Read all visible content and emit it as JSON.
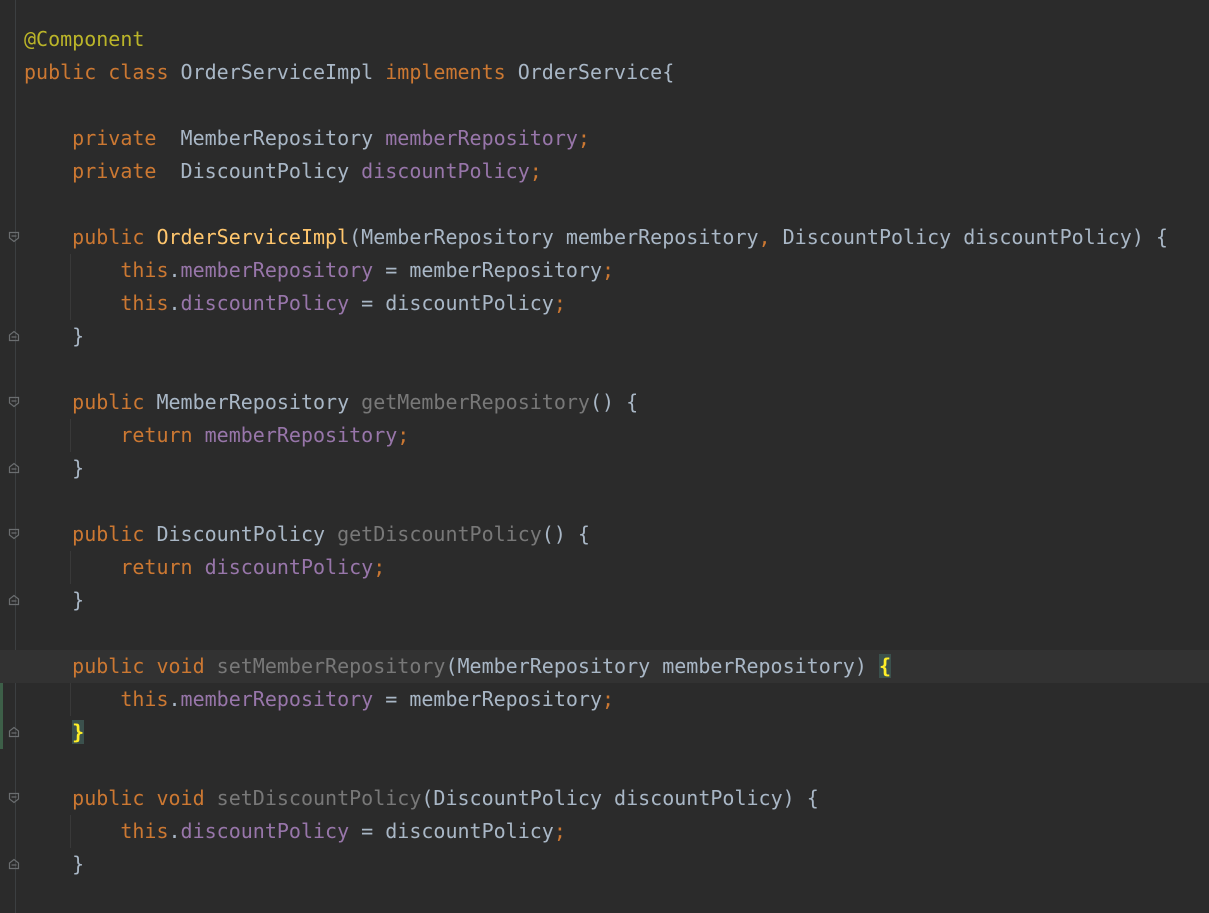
{
  "editor": {
    "language": "java",
    "theme_colors": {
      "background": "#2b2b2b",
      "keyword": "#cc7832",
      "annotation": "#bbb529",
      "field": "#9876aa",
      "method_decl": "#ffc66d",
      "unused": "#787878",
      "default_text": "#a9b7c6",
      "brace_match_bg": "#3b514d",
      "brace_match_fg": "#ffef28",
      "current_line": "#323232"
    },
    "lines": [
      {
        "tokens": [
          {
            "t": "@Component",
            "c": "ann"
          }
        ]
      },
      {
        "tokens": [
          {
            "t": "public class ",
            "c": "kw"
          },
          {
            "t": "OrderServiceImpl ",
            "c": "plain"
          },
          {
            "t": "implements ",
            "c": "kw"
          },
          {
            "t": "OrderService{",
            "c": "plain"
          }
        ]
      },
      {
        "tokens": []
      },
      {
        "tokens": [
          {
            "t": "    ",
            "c": "plain"
          },
          {
            "t": "private  ",
            "c": "kw"
          },
          {
            "t": "MemberRepository ",
            "c": "plain"
          },
          {
            "t": "memberRepository",
            "c": "field"
          },
          {
            "t": ";",
            "c": "punc"
          }
        ]
      },
      {
        "tokens": [
          {
            "t": "    ",
            "c": "plain"
          },
          {
            "t": "private  ",
            "c": "kw"
          },
          {
            "t": "DiscountPolicy ",
            "c": "plain"
          },
          {
            "t": "discountPolicy",
            "c": "field"
          },
          {
            "t": ";",
            "c": "punc"
          }
        ]
      },
      {
        "tokens": []
      },
      {
        "fold": "open",
        "tokens": [
          {
            "t": "    ",
            "c": "plain"
          },
          {
            "t": "public ",
            "c": "kw"
          },
          {
            "t": "OrderServiceImpl",
            "c": "fn"
          },
          {
            "t": "(MemberRepository memberRepository",
            "c": "plain"
          },
          {
            "t": ", ",
            "c": "punc"
          },
          {
            "t": "DiscountPolicy discountPolicy) {",
            "c": "plain"
          }
        ]
      },
      {
        "guide": true,
        "tokens": [
          {
            "t": "        ",
            "c": "plain"
          },
          {
            "t": "this",
            "c": "kw"
          },
          {
            "t": ".",
            "c": "plain"
          },
          {
            "t": "memberRepository",
            "c": "field"
          },
          {
            "t": " = memberRepository",
            "c": "plain"
          },
          {
            "t": ";",
            "c": "punc"
          }
        ]
      },
      {
        "guide": true,
        "tokens": [
          {
            "t": "        ",
            "c": "plain"
          },
          {
            "t": "this",
            "c": "kw"
          },
          {
            "t": ".",
            "c": "plain"
          },
          {
            "t": "discountPolicy",
            "c": "field"
          },
          {
            "t": " = discountPolicy",
            "c": "plain"
          },
          {
            "t": ";",
            "c": "punc"
          }
        ]
      },
      {
        "fold": "close",
        "tokens": [
          {
            "t": "    }",
            "c": "plain"
          }
        ]
      },
      {
        "tokens": []
      },
      {
        "fold": "open",
        "tokens": [
          {
            "t": "    ",
            "c": "plain"
          },
          {
            "t": "public ",
            "c": "kw"
          },
          {
            "t": "MemberRepository ",
            "c": "plain"
          },
          {
            "t": "getMemberRepository",
            "c": "unused"
          },
          {
            "t": "() {",
            "c": "plain"
          }
        ]
      },
      {
        "guide": true,
        "tokens": [
          {
            "t": "        ",
            "c": "plain"
          },
          {
            "t": "return ",
            "c": "kw"
          },
          {
            "t": "memberRepository",
            "c": "field"
          },
          {
            "t": ";",
            "c": "punc"
          }
        ]
      },
      {
        "fold": "close",
        "tokens": [
          {
            "t": "    }",
            "c": "plain"
          }
        ]
      },
      {
        "tokens": []
      },
      {
        "fold": "open",
        "tokens": [
          {
            "t": "    ",
            "c": "plain"
          },
          {
            "t": "public ",
            "c": "kw"
          },
          {
            "t": "DiscountPolicy ",
            "c": "plain"
          },
          {
            "t": "getDiscountPolicy",
            "c": "unused"
          },
          {
            "t": "() {",
            "c": "plain"
          }
        ]
      },
      {
        "guide": true,
        "tokens": [
          {
            "t": "        ",
            "c": "plain"
          },
          {
            "t": "return ",
            "c": "kw"
          },
          {
            "t": "discountPolicy",
            "c": "field"
          },
          {
            "t": ";",
            "c": "punc"
          }
        ]
      },
      {
        "fold": "close",
        "tokens": [
          {
            "t": "    }",
            "c": "plain"
          }
        ]
      },
      {
        "tokens": []
      },
      {
        "fold": "open",
        "current": true,
        "changed": true,
        "tokens": [
          {
            "t": "    ",
            "c": "plain"
          },
          {
            "t": "public void ",
            "c": "kw"
          },
          {
            "t": "setMemberRepository",
            "c": "unused"
          },
          {
            "t": "(MemberRepository memberRepository) ",
            "c": "plain"
          },
          {
            "t": "{",
            "c": "brace"
          }
        ]
      },
      {
        "guide": true,
        "changed": true,
        "tokens": [
          {
            "t": "        ",
            "c": "plain"
          },
          {
            "t": "this",
            "c": "kw"
          },
          {
            "t": ".",
            "c": "plain"
          },
          {
            "t": "memberRepository",
            "c": "field"
          },
          {
            "t": " = memberRepository",
            "c": "plain"
          },
          {
            "t": ";",
            "c": "punc"
          }
        ]
      },
      {
        "fold": "close",
        "changed": true,
        "tokens": [
          {
            "t": "    ",
            "c": "plain"
          },
          {
            "t": "}",
            "c": "brace"
          }
        ]
      },
      {
        "tokens": []
      },
      {
        "fold": "open",
        "tokens": [
          {
            "t": "    ",
            "c": "plain"
          },
          {
            "t": "public void ",
            "c": "kw"
          },
          {
            "t": "setDiscountPolicy",
            "c": "unused"
          },
          {
            "t": "(DiscountPolicy discountPolicy) {",
            "c": "plain"
          }
        ]
      },
      {
        "guide": true,
        "tokens": [
          {
            "t": "        ",
            "c": "plain"
          },
          {
            "t": "this",
            "c": "kw"
          },
          {
            "t": ".",
            "c": "plain"
          },
          {
            "t": "discountPolicy",
            "c": "field"
          },
          {
            "t": " = discountPolicy",
            "c": "plain"
          },
          {
            "t": ";",
            "c": "punc"
          }
        ]
      },
      {
        "fold": "close",
        "tokens": [
          {
            "t": "    }",
            "c": "plain"
          }
        ]
      }
    ]
  }
}
